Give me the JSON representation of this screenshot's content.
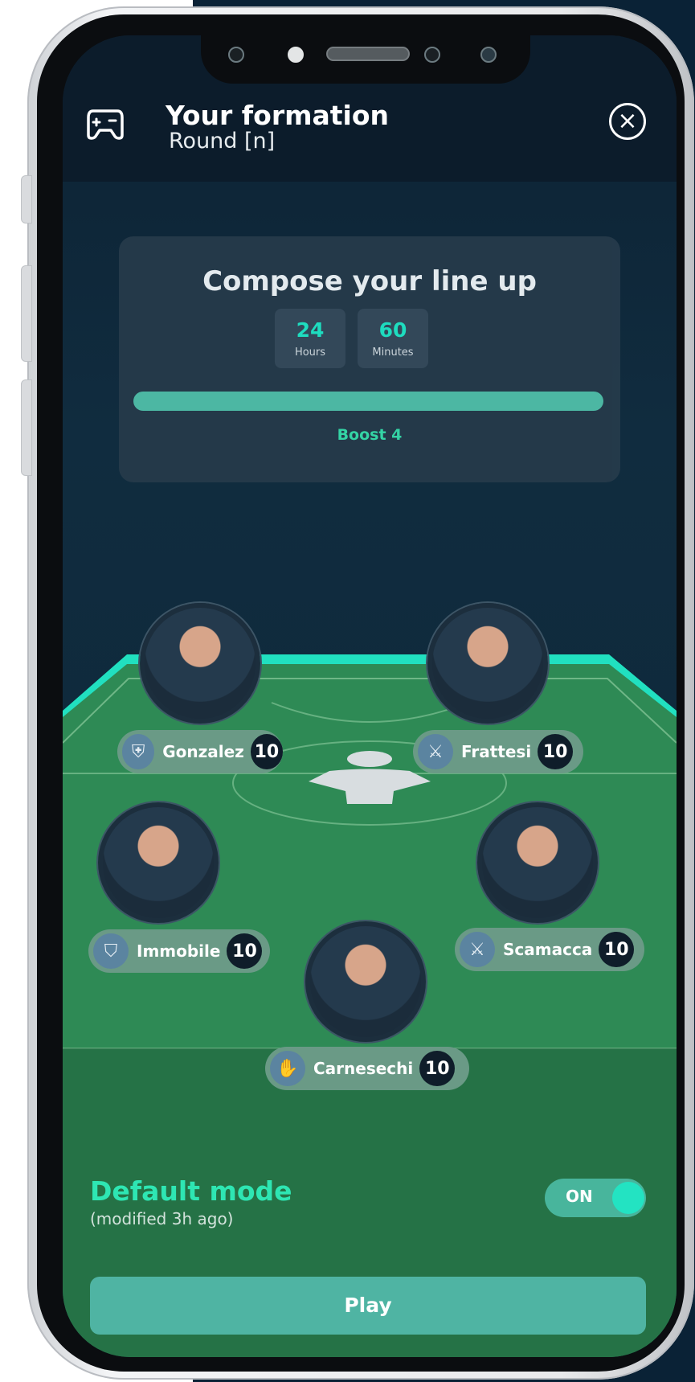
{
  "header": {
    "title": "Your formation",
    "subtitle": "Round [n]",
    "game_icon": "gamepad-icon",
    "close_icon": "close-icon"
  },
  "card": {
    "title": "Compose your line up",
    "hours_value": "24",
    "hours_label": "Hours",
    "minutes_value": "60",
    "minutes_label": "Minutes",
    "progress": 1.0,
    "boost_label": "Boost 4"
  },
  "players": [
    {
      "name": "Gonzalez",
      "score": "10",
      "role_icon": "shield-badge-icon"
    },
    {
      "name": "Frattesi",
      "score": "10",
      "role_icon": "crossed-swords-icon"
    },
    {
      "name": "Immobile",
      "score": "10",
      "role_icon": "shield-icon"
    },
    {
      "name": "Scamacca",
      "score": "10",
      "role_icon": "crossed-swords-icon"
    },
    {
      "name": "Carnesechi",
      "score": "10",
      "role_icon": "gloves-icon"
    }
  ],
  "mode": {
    "title": "Default mode",
    "subtitle": "(modified 3h ago)",
    "toggle_label": "ON",
    "toggle_on": true
  },
  "play_button": "Play",
  "colors": {
    "accent": "#2ee6b3",
    "pitch_green": "#2b8050",
    "navy": "#0d2233",
    "button": "#4fb4a3"
  }
}
